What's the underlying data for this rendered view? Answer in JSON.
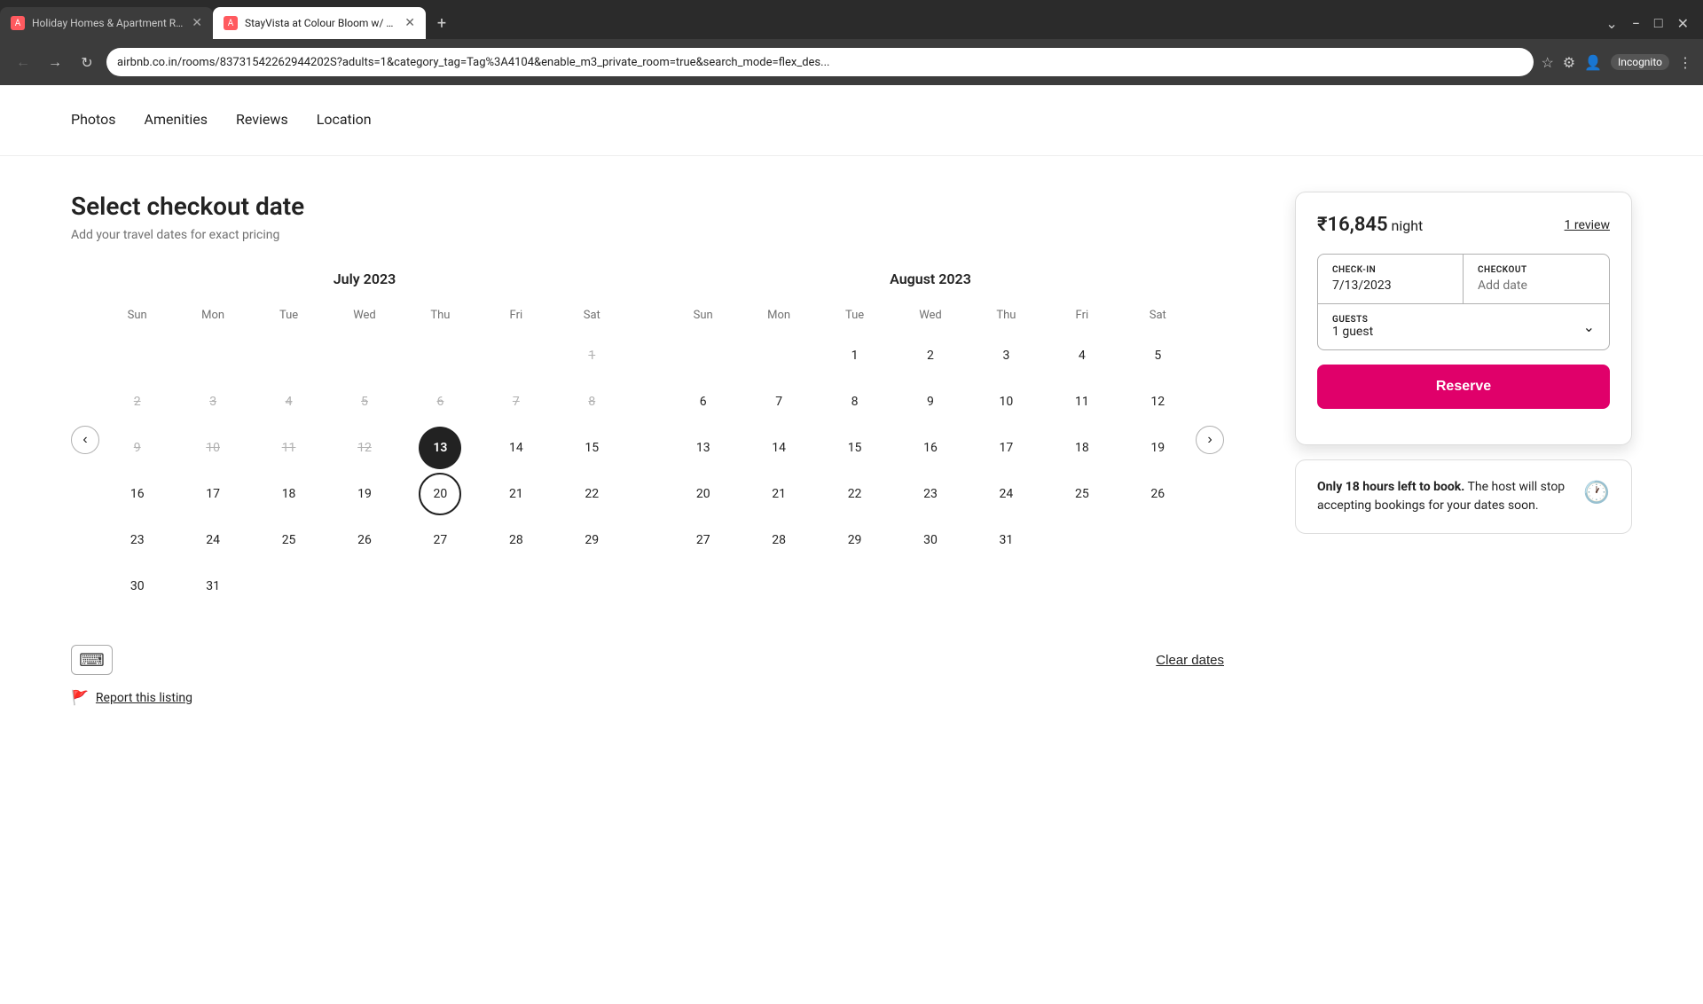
{
  "browser": {
    "tabs": [
      {
        "id": "tab1",
        "favicon": "A",
        "title": "Holiday Homes & Apartment Re...",
        "active": false
      },
      {
        "id": "tab2",
        "favicon": "A",
        "title": "StayVista at Colour Bloom w/ La...",
        "active": true
      }
    ],
    "new_tab_label": "+",
    "address": "airbnb.co.in/rooms/83731542262944202S?adults=1&category_tag=Tag%3A4104&enable_m3_private_room=true&search_mode=flex_des...",
    "incognito_label": "Incognito"
  },
  "nav": {
    "links": [
      "Photos",
      "Amenities",
      "Reviews",
      "Location"
    ]
  },
  "page": {
    "title": "Select checkout date",
    "subtitle": "Add your travel dates for exact pricing"
  },
  "july": {
    "title": "July 2023",
    "days": [
      "Sun",
      "Mon",
      "Tue",
      "Wed",
      "Thu",
      "Fri",
      "Sat"
    ],
    "weeks": [
      [
        "",
        "",
        "",
        "",
        "",
        "",
        "1"
      ],
      [
        "2",
        "3",
        "4",
        "5",
        "6",
        "7",
        "8"
      ],
      [
        "9",
        "10",
        "11",
        "12",
        "13",
        "14",
        "15"
      ],
      [
        "16",
        "17",
        "18",
        "19",
        "20",
        "21",
        "22"
      ],
      [
        "23",
        "24",
        "25",
        "26",
        "27",
        "28",
        "29"
      ],
      [
        "30",
        "31",
        "",
        "",
        "",
        "",
        ""
      ]
    ],
    "disabled_range": [
      1,
      2,
      3,
      4,
      5,
      6,
      7,
      8,
      9,
      10,
      11,
      12
    ],
    "selected_day": "13",
    "hover_day": "20"
  },
  "august": {
    "title": "August 2023",
    "days": [
      "Sun",
      "Mon",
      "Tue",
      "Wed",
      "Thu",
      "Fri",
      "Sat"
    ],
    "weeks": [
      [
        "",
        "",
        "1",
        "2",
        "3",
        "4",
        "5"
      ],
      [
        "6",
        "7",
        "8",
        "9",
        "10",
        "11",
        "12"
      ],
      [
        "13",
        "14",
        "15",
        "16",
        "17",
        "18",
        "19"
      ],
      [
        "20",
        "21",
        "22",
        "23",
        "24",
        "25",
        "26"
      ],
      [
        "27",
        "28",
        "29",
        "30",
        "31",
        "",
        ""
      ]
    ]
  },
  "sidebar": {
    "price": "₹16,845",
    "night_label": "night",
    "review_label": "1 review",
    "checkin_label": "CHECK-IN",
    "checkin_value": "7/13/2023",
    "checkout_label": "CHECKOUT",
    "checkout_placeholder": "Add date",
    "guests_label": "GUESTS",
    "guests_value": "1 guest",
    "reserve_label": "Reserve",
    "urgency_text": "Only 18 hours left to book.",
    "urgency_subtext": " The host will stop accepting bookings for your dates soon.",
    "report_label": "Report this listing"
  },
  "footer": {
    "clear_dates_label": "Clear dates"
  }
}
